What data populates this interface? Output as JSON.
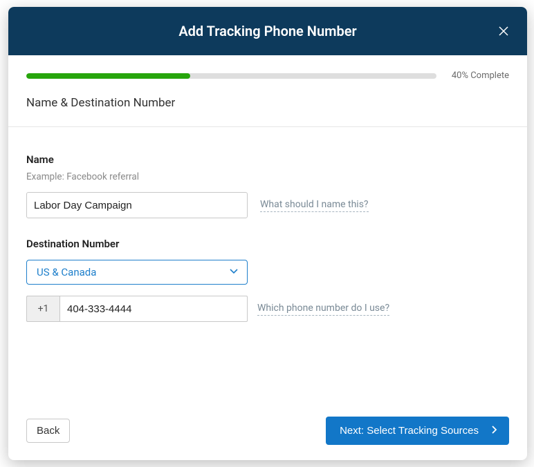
{
  "modal": {
    "title": "Add Tracking Phone Number",
    "progress": {
      "percent": 40,
      "label": "40% Complete"
    },
    "section_title": "Name & Destination Number",
    "name": {
      "label": "Name",
      "hint": "Example: Facebook referral",
      "value": "Labor Day Campaign",
      "help": "What should I name this?"
    },
    "destination": {
      "label": "Destination Number",
      "country_select": "US & Canada",
      "cc": "+1",
      "phone_value": "404-333-4444",
      "help": "Which phone number do I use?"
    },
    "footer": {
      "back": "Back",
      "next": "Next: Select Tracking Sources"
    }
  }
}
